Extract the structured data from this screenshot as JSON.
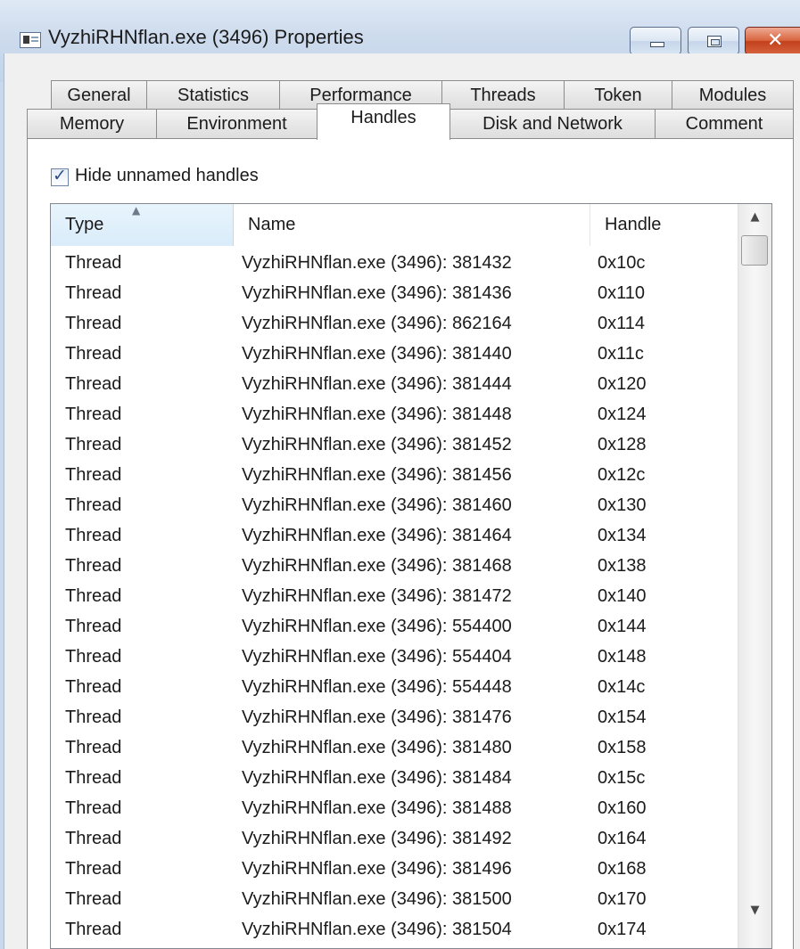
{
  "window": {
    "title": "VyzhiRHNflan.exe (3496) Properties",
    "close_glyph": "✕"
  },
  "tabs": {
    "row1": [
      "General",
      "Statistics",
      "Performance",
      "Threads",
      "Token",
      "Modules"
    ],
    "row2": [
      "Memory",
      "Environment",
      "Handles",
      "Disk and Network",
      "Comment"
    ],
    "selected": "Handles"
  },
  "options": {
    "hide_unnamed_label": "Hide unnamed handles",
    "hide_unnamed_checked": true,
    "check_glyph": "✓"
  },
  "handles_list": {
    "columns": [
      "Type",
      "Name",
      "Handle"
    ],
    "sort_column": "Type",
    "sort_glyph": "▲",
    "scroll_up_glyph": "▲",
    "scroll_down_glyph": "▼",
    "rows": [
      [
        "Thread",
        "VyzhiRHNflan.exe (3496): 381432",
        "0x10c"
      ],
      [
        "Thread",
        "VyzhiRHNflan.exe (3496): 381436",
        "0x110"
      ],
      [
        "Thread",
        "VyzhiRHNflan.exe (3496): 862164",
        "0x114"
      ],
      [
        "Thread",
        "VyzhiRHNflan.exe (3496): 381440",
        "0x11c"
      ],
      [
        "Thread",
        "VyzhiRHNflan.exe (3496): 381444",
        "0x120"
      ],
      [
        "Thread",
        "VyzhiRHNflan.exe (3496): 381448",
        "0x124"
      ],
      [
        "Thread",
        "VyzhiRHNflan.exe (3496): 381452",
        "0x128"
      ],
      [
        "Thread",
        "VyzhiRHNflan.exe (3496): 381456",
        "0x12c"
      ],
      [
        "Thread",
        "VyzhiRHNflan.exe (3496): 381460",
        "0x130"
      ],
      [
        "Thread",
        "VyzhiRHNflan.exe (3496): 381464",
        "0x134"
      ],
      [
        "Thread",
        "VyzhiRHNflan.exe (3496): 381468",
        "0x138"
      ],
      [
        "Thread",
        "VyzhiRHNflan.exe (3496): 381472",
        "0x140"
      ],
      [
        "Thread",
        "VyzhiRHNflan.exe (3496): 554400",
        "0x144"
      ],
      [
        "Thread",
        "VyzhiRHNflan.exe (3496): 554404",
        "0x148"
      ],
      [
        "Thread",
        "VyzhiRHNflan.exe (3496): 554448",
        "0x14c"
      ],
      [
        "Thread",
        "VyzhiRHNflan.exe (3496): 381476",
        "0x154"
      ],
      [
        "Thread",
        "VyzhiRHNflan.exe (3496): 381480",
        "0x158"
      ],
      [
        "Thread",
        "VyzhiRHNflan.exe (3496): 381484",
        "0x15c"
      ],
      [
        "Thread",
        "VyzhiRHNflan.exe (3496): 381488",
        "0x160"
      ],
      [
        "Thread",
        "VyzhiRHNflan.exe (3496): 381492",
        "0x164"
      ],
      [
        "Thread",
        "VyzhiRHNflan.exe (3496): 381496",
        "0x168"
      ],
      [
        "Thread",
        "VyzhiRHNflan.exe (3496): 381500",
        "0x170"
      ],
      [
        "Thread",
        "VyzhiRHNflan.exe (3496): 381504",
        "0x174"
      ]
    ]
  },
  "colors": {
    "titlebar": "#cddbed",
    "close_button": "#c2401c",
    "sorted_header": "#d9ecfa",
    "dialog_face": "#f0f0f0"
  }
}
